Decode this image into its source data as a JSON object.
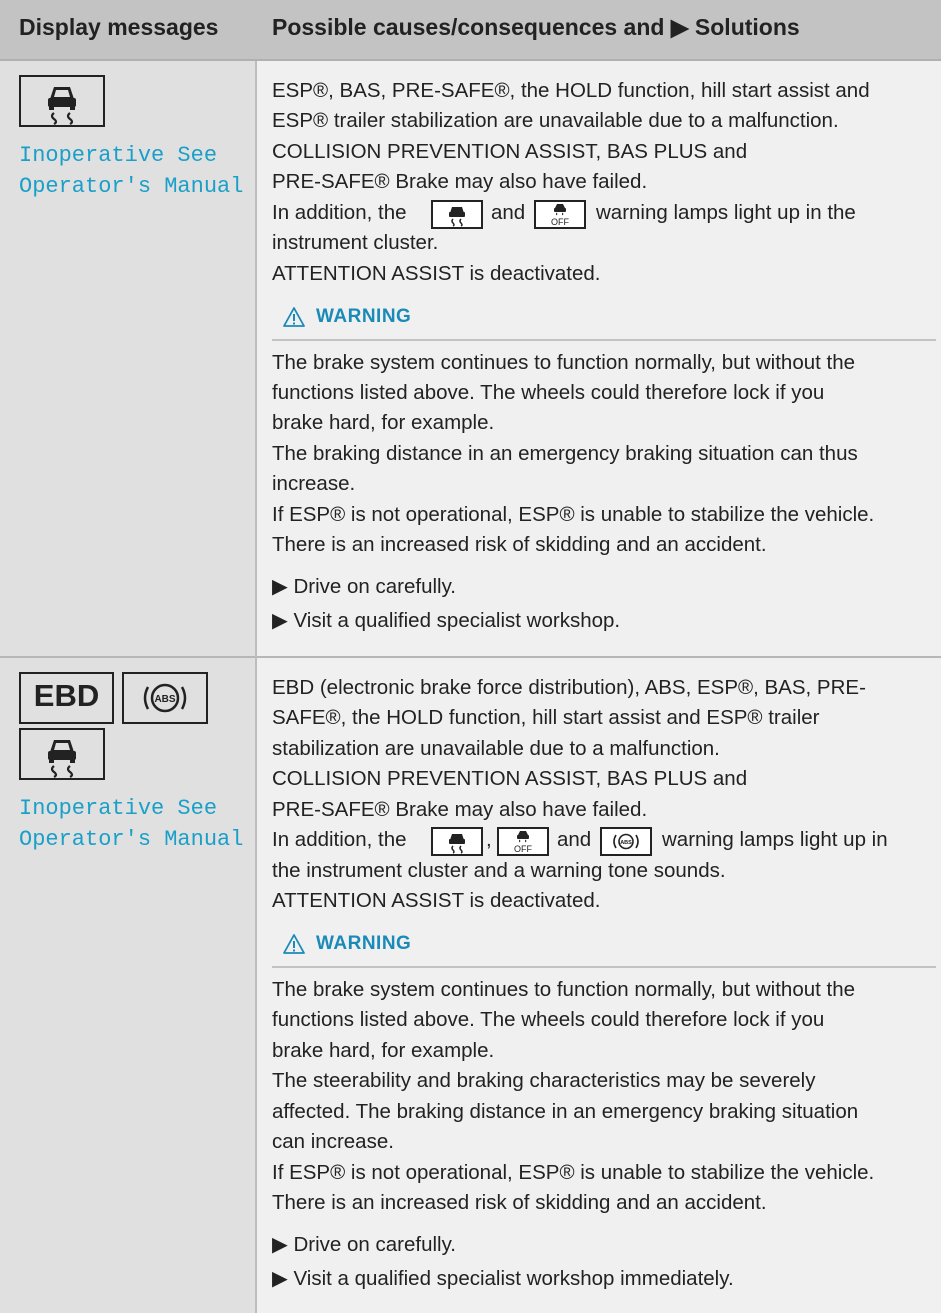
{
  "header": {
    "col1": "Display messages",
    "col2": "Possible causes/consequences and ▶ Solutions"
  },
  "rows": [
    {
      "display": {
        "icons": [
          "esp-skid-icon"
        ],
        "message_line1": "Inoperative See",
        "message_line2": "Operator's Manual"
      },
      "lines": [
        "ESP®, BAS, PRE-SAFE®, the HOLD function, hill start assist and",
        "ESP® trailer stabilization are unavailable due to a malfunction.",
        "COLLISION PREVENTION ASSIST, BAS PLUS and",
        "PRE-SAFE® Brake may also have failed.",
        "In addition, the",
        "and",
        "warning lamps light up in the",
        "instrument cluster.",
        "ATTENTION ASSIST is deactivated."
      ],
      "warning_label": "WARNING",
      "warning_lines": [
        "The brake system continues to function normally, but without the",
        "functions listed above. The wheels could therefore lock if you",
        "brake hard, for example.",
        "The braking distance in an emergency braking situation can thus",
        "increase.",
        "If ESP® is not operational, ESP® is unable to stabilize the vehicle.",
        "There is an increased risk of skidding and an accident."
      ],
      "steps": [
        "▶ Drive on carefully.",
        "▶ Visit a qualified specialist workshop."
      ]
    },
    {
      "display": {
        "icons": [
          "ebd-label",
          "abs-icon",
          "esp-skid-icon"
        ],
        "ebd_text": "EBD",
        "abs_text": "ABS",
        "message_line1": "Inoperative See",
        "message_line2": "Operator's Manual"
      },
      "lines": [
        "EBD (electronic brake force distribution), ABS, ESP®, BAS, PRE-",
        "SAFE®, the HOLD function, hill start assist and ESP® trailer",
        "stabilization are unavailable due to a malfunction.",
        "COLLISION PREVENTION ASSIST, BAS PLUS and",
        "PRE-SAFE® Brake may also have failed.",
        "In addition, the",
        ",",
        "and",
        "warning lamps light up in",
        "the instrument cluster and a warning tone sounds.",
        "ATTENTION ASSIST is deactivated."
      ],
      "warning_label": "WARNING",
      "warning_lines": [
        "The brake system continues to function normally, but without the",
        "functions listed above. The wheels could therefore lock if you",
        "brake hard, for example.",
        "The steerability and braking characteristics may be severely",
        "affected. The braking distance in an emergency braking situation",
        "can increase.",
        "If ESP® is not operational, ESP® is unable to stabilize the vehicle.",
        "There is an increased risk of skidding and an accident."
      ],
      "steps": [
        "▶ Drive on carefully.",
        "▶ Visit a qualified specialist workshop immediately."
      ]
    }
  ],
  "colors": {
    "header_bg": "#c3c3c3",
    "left_col_bg": "#e0e0e0",
    "right_col_bg": "#f0f0f0",
    "accent": "#1aa0c8",
    "warning_text": "#1a8ab8"
  }
}
